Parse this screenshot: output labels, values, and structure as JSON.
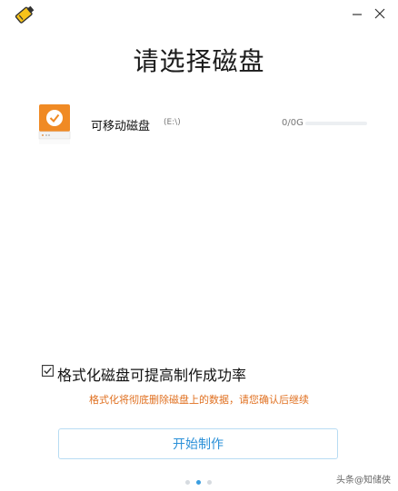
{
  "window": {
    "app_icon": "usb-drive-icon",
    "minimize_icon": "minimize-icon",
    "close_icon": "close-icon"
  },
  "page_title": "请选择磁盘",
  "disk": {
    "name": "可移动磁盘",
    "letter": "(E:\\)",
    "capacity": "0/0G",
    "used_fraction": 0,
    "icon": "removable-disk-icon",
    "selected": true
  },
  "format_option": {
    "checked": true,
    "label": "格式化磁盘可提高制作成功率"
  },
  "warning": "格式化将彻底删除磁盘上的数据，请您确认后继续",
  "start_button": "开始制作",
  "pager": {
    "count": 3,
    "active": 1
  },
  "watermark": "头条@知储侠",
  "colors": {
    "accent": "#2a90d8",
    "warning": "#e07020",
    "disk_orange": "#f08a24"
  }
}
